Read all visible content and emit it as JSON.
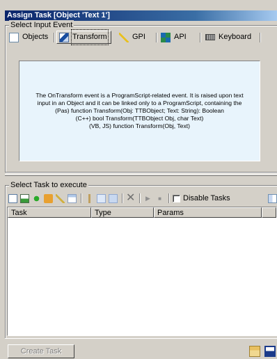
{
  "window": {
    "title": "Assign Task [Object 'Text 1']"
  },
  "input_event": {
    "group_label": "Select Input Event",
    "tabs": [
      {
        "label": "Objects",
        "icon": "objects-icon"
      },
      {
        "label": "Transform",
        "icon": "transform-icon",
        "active": true
      },
      {
        "label": "GPI",
        "icon": "gpi-icon"
      },
      {
        "label": "API",
        "icon": "api-icon"
      },
      {
        "label": "Keyboard",
        "icon": "keyboard-icon"
      }
    ],
    "description_lines": [
      "The OnTransform event is a ProgramScript-related event. It is raised upon text",
      "input in an Object and it can be linked only to a ProgramScript, containing the",
      "(Pas) function Transform(Obj: TTBObject; Text: String): Boolean",
      "(C++) bool Transform(TTBObject Obj, char Text)",
      "(VB, JS) function Transform(Obj, Text)"
    ]
  },
  "task_section": {
    "group_label": "Select Task to execute",
    "disable_tasks_label": "Disable Tasks",
    "columns": [
      "Task",
      "Type",
      "Params"
    ]
  },
  "footer": {
    "create_task_label": "Create Task"
  },
  "colors": {
    "title_bar": "#0a246a",
    "description_bg": "#e8f4fc",
    "face": "#d4d0c8"
  }
}
